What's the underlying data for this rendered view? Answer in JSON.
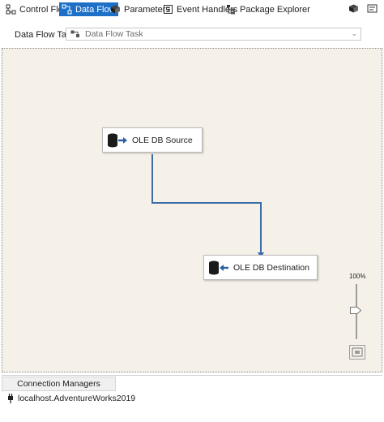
{
  "tabs": [
    {
      "label": "Control Flow",
      "icon": "control-flow-icon",
      "active": false
    },
    {
      "label": "Data Flow",
      "icon": "data-flow-icon",
      "active": true
    },
    {
      "label": "Parameters",
      "icon": "parameters-icon",
      "active": false
    },
    {
      "label": "Event Handlers",
      "icon": "event-handlers-icon",
      "active": false
    },
    {
      "label": "Package Explorer",
      "icon": "package-explorer-icon",
      "active": false
    }
  ],
  "task": {
    "label": "Data Flow Task:",
    "value": "Data Flow Task"
  },
  "components": {
    "source": {
      "label": "OLE DB Source"
    },
    "destination": {
      "label": "OLE DB Destination"
    }
  },
  "zoom": {
    "level": "100%"
  },
  "connection_managers": {
    "tab_label": "Connection Managers",
    "items": [
      "localhost.AdventureWorks2019"
    ]
  },
  "colors": {
    "accent": "#1e6fc7",
    "canvas": "#f5f1e8",
    "flow_arrow": "#3c6ca8"
  }
}
